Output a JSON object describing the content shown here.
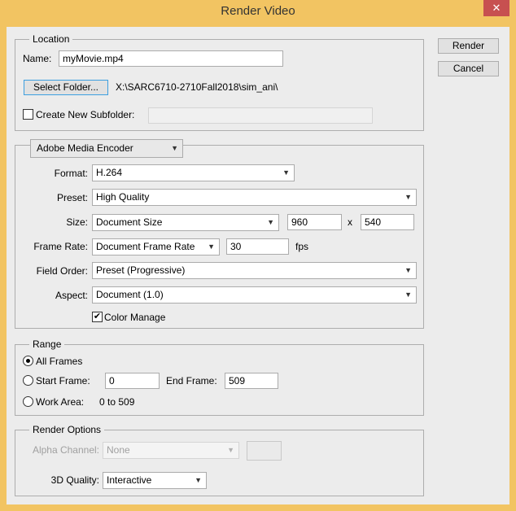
{
  "window": {
    "title": "Render Video",
    "close": "✕"
  },
  "buttons": {
    "render": "Render",
    "cancel": "Cancel"
  },
  "location": {
    "legend": "Location",
    "name_label": "Name:",
    "name_value": "myMovie.mp4",
    "select_folder": "Select Folder...",
    "folder_path": "X:\\SARC6710-2710Fall2018\\sim_ani\\",
    "subfolder_label": "Create New Subfolder:",
    "subfolder_checked": false,
    "subfolder_value": ""
  },
  "encoder": {
    "selected": "Adobe Media Encoder",
    "format_label": "Format:",
    "format": "H.264",
    "preset_label": "Preset:",
    "preset": "High Quality",
    "size_label": "Size:",
    "size": "Document Size",
    "width": "960",
    "x": "x",
    "height": "540",
    "framerate_label": "Frame Rate:",
    "framerate_preset": "Document Frame Rate",
    "fps_value": "30",
    "fps": "fps",
    "fieldorder_label": "Field Order:",
    "fieldorder": "Preset (Progressive)",
    "aspect_label": "Aspect:",
    "aspect": "Document (1.0)",
    "color_manage": "Color Manage",
    "color_manage_checked": true
  },
  "range": {
    "legend": "Range",
    "all_frames": "All Frames",
    "start_frame_label": "Start Frame:",
    "start_frame": "0",
    "end_frame_label": "End Frame:",
    "end_frame": "509",
    "work_area_label": "Work Area:",
    "work_area": "0 to 509",
    "selected": "all_frames"
  },
  "render_options": {
    "legend": "Render Options",
    "alpha_label": "Alpha Channel:",
    "alpha": "None",
    "quality_label": "3D Quality:",
    "quality": "Interactive"
  }
}
